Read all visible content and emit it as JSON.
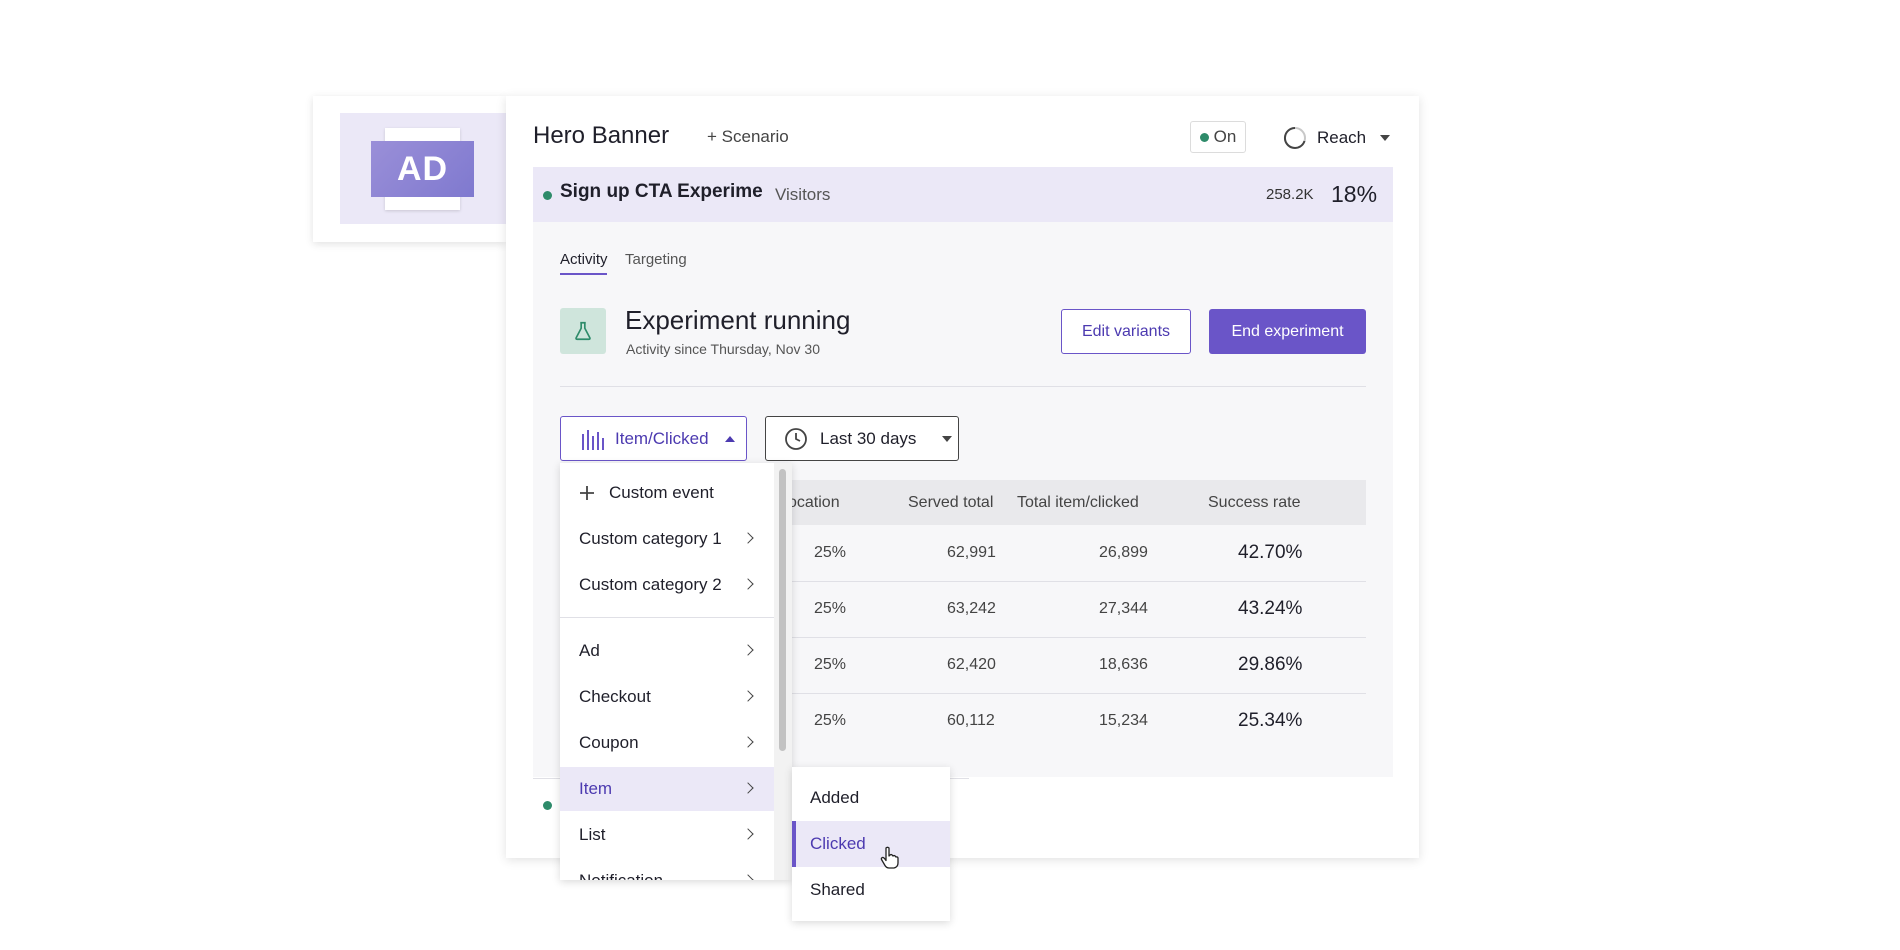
{
  "thumbnail": {
    "ad_text": "AD"
  },
  "header": {
    "title": "Hero Banner",
    "scenario_link": "+ Scenario",
    "status": "On",
    "reach_label": "Reach"
  },
  "experiment": {
    "name": "Sign up CTA Experime",
    "visitors_label": "Visitors",
    "visitor_count": "258.2K",
    "share_pct": "18%"
  },
  "tabs": {
    "activity": "Activity",
    "targeting": "Targeting"
  },
  "running": {
    "title": "Experiment running",
    "subtitle": "Activity since Thursday, Nov 30",
    "edit_label": "Edit variants",
    "end_label": "End experiment"
  },
  "filters": {
    "metric": "Item/Clicked",
    "range": "Last 30 days"
  },
  "table": {
    "headers": {
      "allocation": "ocation",
      "served": "Served total",
      "clicked": "Total item/clicked",
      "success": "Success rate"
    },
    "rows": [
      {
        "allocation": "25%",
        "served": "62,991",
        "clicked": "26,899",
        "success": "42.70%"
      },
      {
        "allocation": "25%",
        "served": "63,242",
        "clicked": "27,344",
        "success": "43.24%"
      },
      {
        "allocation": "25%",
        "served": "62,420",
        "clicked": "18,636",
        "success": "29.86%"
      },
      {
        "allocation": "25%",
        "served": "60,112",
        "clicked": "15,234",
        "success": "25.34%"
      }
    ]
  },
  "menu": {
    "custom_event": "Custom event",
    "items": [
      "Custom category 1",
      "Custom category 2",
      "Ad",
      "Checkout",
      "Coupon",
      "Item",
      "List",
      "Notification"
    ]
  },
  "submenu": {
    "items": [
      "Added",
      "Clicked",
      "Shared"
    ]
  },
  "colors": {
    "accent": "#6a55c8",
    "status_green": "#2e8b6a",
    "highlight": "#ebe8f7"
  }
}
